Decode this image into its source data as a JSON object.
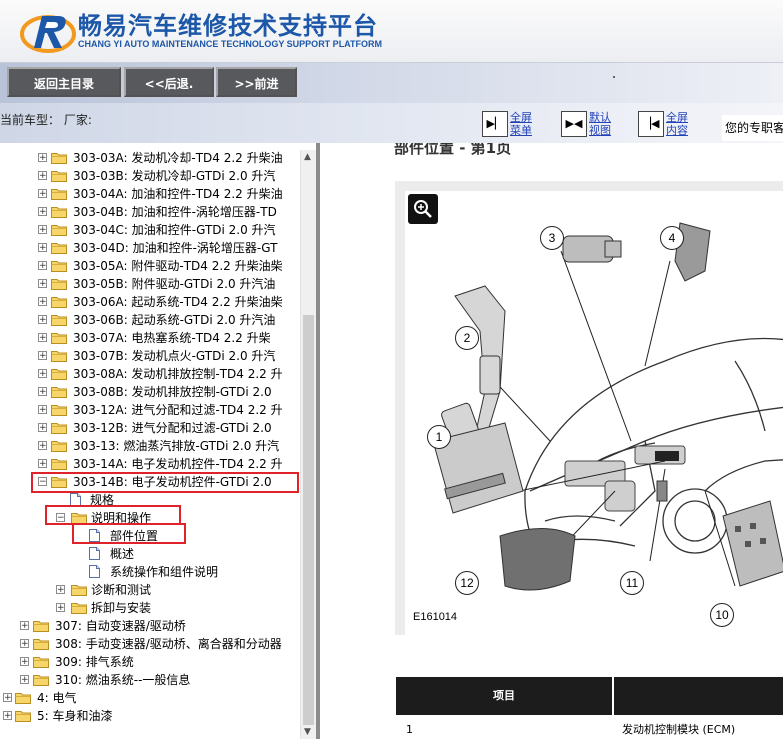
{
  "header": {
    "title": "畅易汽车维修技术支持平台",
    "subtitle": "CHANG YI AUTO MAINTENANCE TECHNOLOGY SUPPORT PLATFORM",
    "logo_icon": "cy-logo-icon"
  },
  "toolbar": {
    "home_label": "返回主目录",
    "back_label": "<<后退.",
    "forward_label": ">>前进"
  },
  "infobar": {
    "car_type": "当前车型： 厂家:",
    "view_buttons": [
      {
        "label": "全屏\n菜单",
        "icon": "fullscreen-menu-icon"
      },
      {
        "label": "默认\n视图",
        "icon": "default-view-icon"
      },
      {
        "label": "全屏\n内容",
        "icon": "fullscreen-content-icon"
      }
    ],
    "exclusive_text": "您的专职客"
  },
  "tree": {
    "items": [
      {
        "label": "303-03A: 发动机冷却-TD4 2.2 升柴油"
      },
      {
        "label": "303-03B: 发动机冷却-GTDi 2.0 升汽"
      },
      {
        "label": "303-04A: 加油和控件-TD4 2.2 升柴油"
      },
      {
        "label": "303-04B: 加油和控件-涡轮增压器-TD"
      },
      {
        "label": "303-04C: 加油和控件-GTDi 2.0 升汽"
      },
      {
        "label": "303-04D: 加油和控件-涡轮增压器-GT"
      },
      {
        "label": "303-05A: 附件驱动-TD4 2.2 升柴油柴"
      },
      {
        "label": "303-05B: 附件驱动-GTDi 2.0 升汽油"
      },
      {
        "label": "303-06A: 起动系统-TD4 2.2 升柴油柴"
      },
      {
        "label": "303-06B: 起动系统-GTDi 2.0 升汽油"
      },
      {
        "label": "303-07A: 电热塞系统-TD4 2.2 升柴"
      },
      {
        "label": "303-07B: 发动机点火-GTDi 2.0 升汽"
      },
      {
        "label": "303-08A: 发动机排放控制-TD4 2.2 升"
      },
      {
        "label": "303-08B: 发动机排放控制-GTDi 2.0"
      },
      {
        "label": "303-12A: 进气分配和过滤-TD4 2.2 升"
      },
      {
        "label": "303-12B: 进气分配和过滤-GTDi 2.0"
      },
      {
        "label": "303-13: 燃油蒸汽排放-GTDi 2.0 升汽"
      },
      {
        "label": "303-14A: 电子发动机控件-TD4 2.2 升"
      },
      {
        "label": "303-14B: 电子发动机控件-GTDi 2.0"
      },
      {
        "label": "规格"
      },
      {
        "label": "说明和操作"
      },
      {
        "label": "部件位置"
      },
      {
        "label": "概述"
      },
      {
        "label": "系统操作和组件说明"
      },
      {
        "label": "诊断和测试"
      },
      {
        "label": "拆卸与安装"
      },
      {
        "label": "307: 自动变速器/驱动桥"
      },
      {
        "label": "308: 手动变速器/驱动桥、离合器和分动器"
      },
      {
        "label": "309: 排气系统"
      },
      {
        "label": "310: 燃油系统--一般信息"
      },
      {
        "label": "4: 电气"
      },
      {
        "label": "5: 车身和油漆"
      }
    ]
  },
  "content": {
    "heading": "部件位置 - 第1页",
    "figure": {
      "code": "E161014",
      "callouts": [
        "1",
        "2",
        "3",
        "4",
        "10",
        "11",
        "12"
      ]
    },
    "table": {
      "headers": [
        "项目",
        ""
      ],
      "rows": [
        {
          "item": "1",
          "desc": "发动机控制模块 (ECM)"
        }
      ]
    }
  },
  "colors": {
    "title_blue": "#1d57a8",
    "highlight_red": "#e0222b",
    "nav_button_gray": "#58595d"
  }
}
